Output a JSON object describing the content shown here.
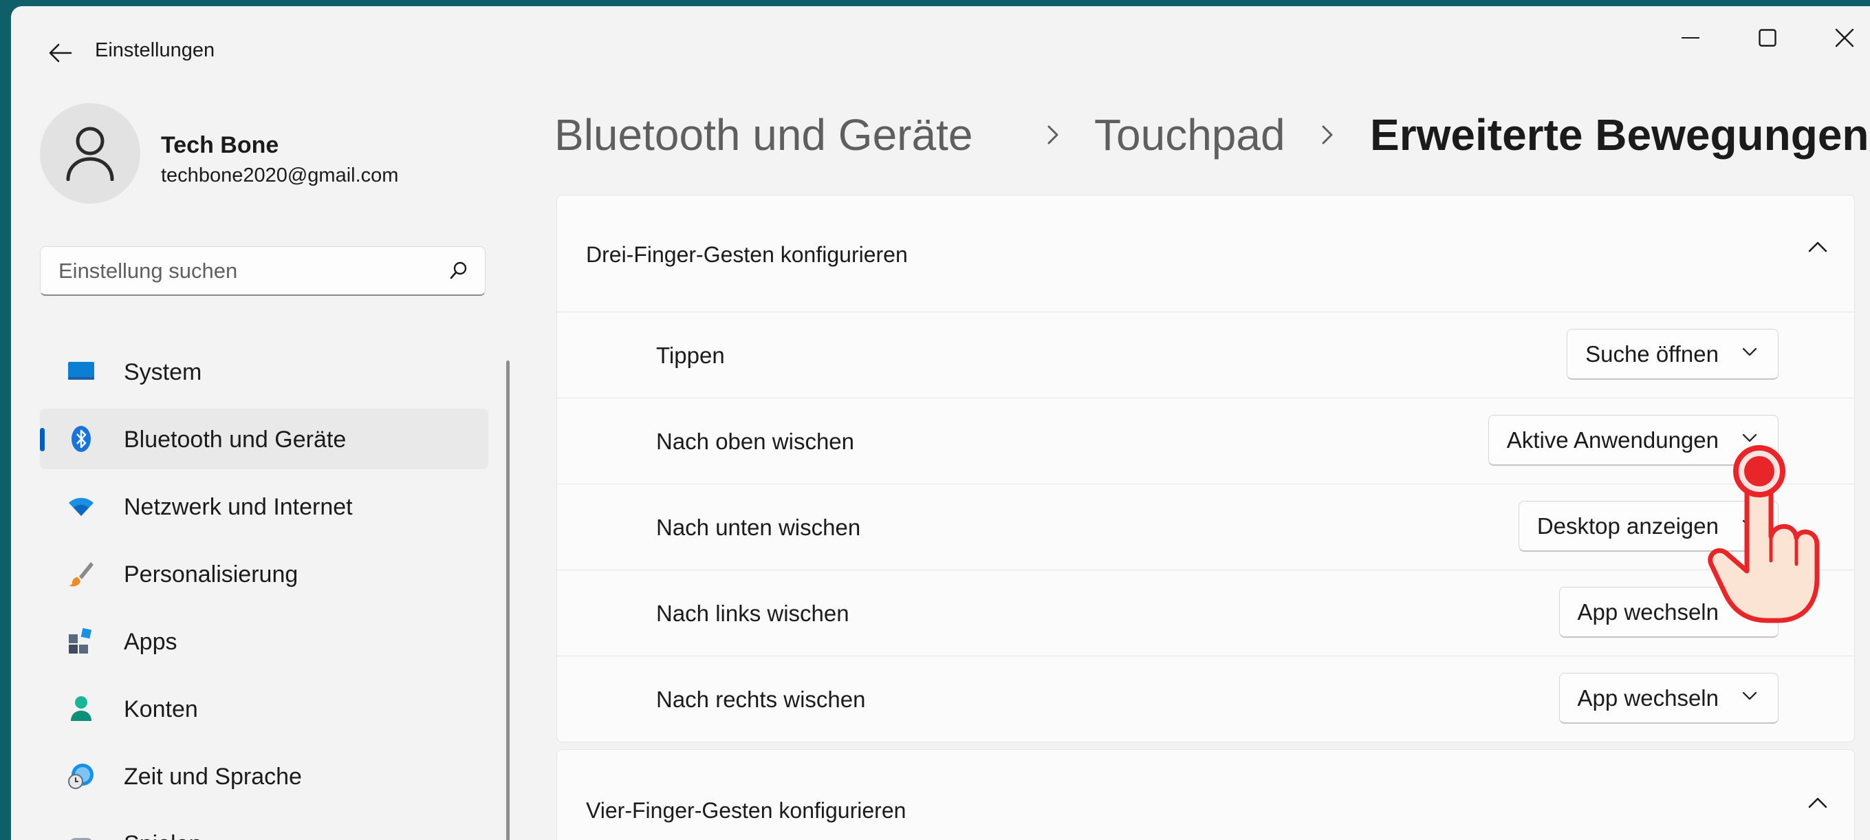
{
  "window": {
    "title": "Einstellungen"
  },
  "profile": {
    "name": "Tech Bone",
    "email": "techbone2020@gmail.com"
  },
  "search": {
    "placeholder": "Einstellung suchen"
  },
  "nav": {
    "items": [
      {
        "label": "System",
        "icon": "monitor-icon"
      },
      {
        "label": "Bluetooth und Geräte",
        "icon": "bluetooth-icon",
        "selected": true
      },
      {
        "label": "Netzwerk und Internet",
        "icon": "wifi-icon"
      },
      {
        "label": "Personalisierung",
        "icon": "brush-icon"
      },
      {
        "label": "Apps",
        "icon": "apps-icon"
      },
      {
        "label": "Konten",
        "icon": "person-icon"
      },
      {
        "label": "Zeit und Sprache",
        "icon": "globe-clock-icon"
      },
      {
        "label": "Spielen",
        "icon": "gamepad-icon"
      }
    ]
  },
  "breadcrumb": {
    "items": [
      "Bluetooth und Geräte",
      "Touchpad",
      "Erweiterte Bewegungen"
    ]
  },
  "three_finger": {
    "title": "Drei-Finger-Gesten konfigurieren",
    "rows": [
      {
        "label": "Tippen",
        "value": "Suche öffnen"
      },
      {
        "label": "Nach oben wischen",
        "value": "Aktive Anwendungen"
      },
      {
        "label": "Nach unten wischen",
        "value": "Desktop anzeigen"
      },
      {
        "label": "Nach links wischen",
        "value": "App wechseln"
      },
      {
        "label": "Nach rechts wischen",
        "value": "App wechseln"
      }
    ]
  },
  "four_finger": {
    "title": "Vier-Finger-Gesten konfigurieren"
  },
  "colors": {
    "accent": "#005fb8",
    "background": "#f3f3f3",
    "card": "#fbfbfb",
    "desktop": "#0e5f6a",
    "pointer": "#e8262a"
  }
}
